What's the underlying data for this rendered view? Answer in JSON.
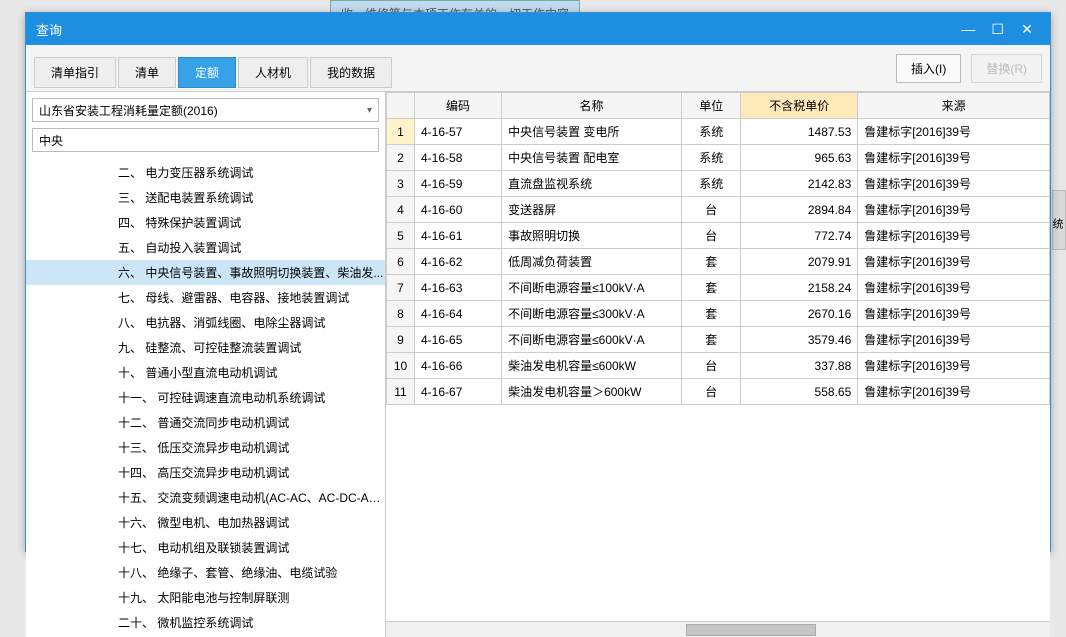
{
  "background": {
    "hint_text": "收、维修等与本项工作有关的一切工作内容"
  },
  "window": {
    "title": "查询"
  },
  "tabs": [
    "清单指引",
    "清单",
    "定额",
    "人材机",
    "我的数据"
  ],
  "active_tab_index": 2,
  "buttons": {
    "insert": "插入(I)",
    "replace": "替换(R)"
  },
  "left": {
    "combo": "山东省安装工程消耗量定额(2016)",
    "search_value": "中央",
    "nodes": [
      {
        "label": "二、 电力变压器系统调试"
      },
      {
        "label": "三、 送配电装置系统调试"
      },
      {
        "label": "四、 特殊保护装置调试"
      },
      {
        "label": "五、 自动投入装置调试"
      },
      {
        "label": "六、 中央信号装置、事故照明切换装置、柴油发...",
        "selected": true
      },
      {
        "label": "七、 母线、避雷器、电容器、接地装置调试"
      },
      {
        "label": "八、 电抗器、消弧线圈、电除尘器调试"
      },
      {
        "label": "九、 硅整流、可控硅整流装置调试"
      },
      {
        "label": "十、 普通小型直流电动机调试"
      },
      {
        "label": "十一、 可控硅调速直流电动机系统调试"
      },
      {
        "label": "十二、 普通交流同步电动机调试"
      },
      {
        "label": "十三、 低压交流异步电动机调试"
      },
      {
        "label": "十四、 高压交流异步电动机调试"
      },
      {
        "label": "十五、 交流变频调速电动机(AC-AC、AC-DC-AC..."
      },
      {
        "label": "十六、 微型电机、电加热器调试"
      },
      {
        "label": "十七、 电动机组及联锁装置调试"
      },
      {
        "label": "十八、 绝缘子、套管、绝缘油、电缆试验"
      },
      {
        "label": "十九、 太阳能电池与控制屏联测"
      },
      {
        "label": "二十、 微机监控系统调试"
      }
    ]
  },
  "grid": {
    "headers": {
      "code": "编码",
      "name": "名称",
      "unit": "单位",
      "price": "不含税单价",
      "source": "来源"
    },
    "rows": [
      {
        "n": 1,
        "code": "4-16-57",
        "name": "中央信号装置 变电所",
        "unit": "系统",
        "price": "1487.53",
        "source": "鲁建标字[2016]39号",
        "sel": true
      },
      {
        "n": 2,
        "code": "4-16-58",
        "name": "中央信号装置 配电室",
        "unit": "系统",
        "price": "965.63",
        "source": "鲁建标字[2016]39号"
      },
      {
        "n": 3,
        "code": "4-16-59",
        "name": "直流盘监视系统",
        "unit": "系统",
        "price": "2142.83",
        "source": "鲁建标字[2016]39号"
      },
      {
        "n": 4,
        "code": "4-16-60",
        "name": "变送器屏",
        "unit": "台",
        "price": "2894.84",
        "source": "鲁建标字[2016]39号"
      },
      {
        "n": 5,
        "code": "4-16-61",
        "name": "事故照明切换",
        "unit": "台",
        "price": "772.74",
        "source": "鲁建标字[2016]39号"
      },
      {
        "n": 6,
        "code": "4-16-62",
        "name": "低周减负荷装置",
        "unit": "套",
        "price": "2079.91",
        "source": "鲁建标字[2016]39号"
      },
      {
        "n": 7,
        "code": "4-16-63",
        "name": "不间断电源容量≤100kV·A",
        "unit": "套",
        "price": "2158.24",
        "source": "鲁建标字[2016]39号"
      },
      {
        "n": 8,
        "code": "4-16-64",
        "name": "不间断电源容量≤300kV·A",
        "unit": "套",
        "price": "2670.16",
        "source": "鲁建标字[2016]39号"
      },
      {
        "n": 9,
        "code": "4-16-65",
        "name": "不间断电源容量≤600kV·A",
        "unit": "套",
        "price": "3579.46",
        "source": "鲁建标字[2016]39号"
      },
      {
        "n": 10,
        "code": "4-16-66",
        "name": "柴油发电机容量≤600kW",
        "unit": "台",
        "price": "337.88",
        "source": "鲁建标字[2016]39号"
      },
      {
        "n": 11,
        "code": "4-16-67",
        "name": "柴油发电机容量＞600kW",
        "unit": "台",
        "price": "558.65",
        "source": "鲁建标字[2016]39号"
      }
    ]
  },
  "rightedge": "统"
}
